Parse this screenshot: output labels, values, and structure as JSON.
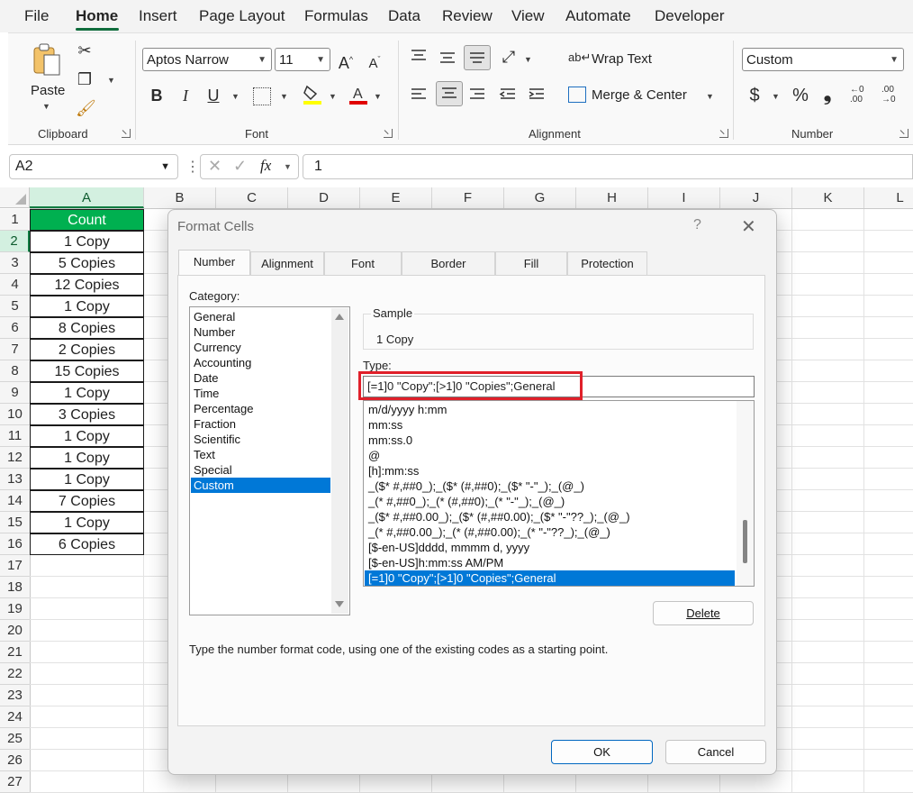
{
  "menu": {
    "tabs": [
      "File",
      "Home",
      "Insert",
      "Page Layout",
      "Formulas",
      "Data",
      "Review",
      "View",
      "Automate",
      "Developer"
    ],
    "active": "Home"
  },
  "ribbon": {
    "clipboard": {
      "paste_label": "Paste",
      "group_label": "Clipboard"
    },
    "font": {
      "font_name": "Aptos Narrow",
      "font_size": "11",
      "group_label": "Font",
      "bold": "B",
      "italic": "I",
      "underline": "U"
    },
    "alignment": {
      "wrap_text": "Wrap Text",
      "merge_center": "Merge & Center",
      "group_label": "Alignment"
    },
    "number": {
      "format": "Custom",
      "currency": "$",
      "percent": "%",
      "comma": "❟",
      "group_label": "Number"
    }
  },
  "formula_bar": {
    "name_box": "A2",
    "fx": "fx",
    "formula": "1"
  },
  "sheet": {
    "columns": [
      "A",
      "B",
      "C",
      "D",
      "E",
      "F",
      "G",
      "H",
      "I",
      "J",
      "K",
      "L"
    ],
    "rows": [
      "1",
      "2",
      "3",
      "4",
      "5",
      "6",
      "7",
      "8",
      "9",
      "10",
      "11",
      "12",
      "13",
      "14",
      "15",
      "16",
      "17",
      "18",
      "19",
      "20",
      "21",
      "22",
      "23",
      "24",
      "25",
      "26",
      "27"
    ],
    "cells": [
      "Count",
      "1 Copy",
      "5 Copies",
      "12 Copies",
      "1 Copy",
      "8 Copies",
      "2 Copies",
      "15 Copies",
      "1 Copy",
      "3 Copies",
      "1 Copy",
      "1 Copy",
      "1 Copy",
      "7 Copies",
      "1 Copy",
      "6 Copies"
    ],
    "header_color": "#00b050"
  },
  "dialog": {
    "title": "Format Cells",
    "help": "?",
    "close": "✕",
    "tabs": [
      "Number",
      "Alignment",
      "Font",
      "Border",
      "Fill",
      "Protection"
    ],
    "active_tab": "Number",
    "category_label": "Category:",
    "categories": [
      "General",
      "Number",
      "Currency",
      "Accounting",
      "Date",
      "Time",
      "Percentage",
      "Fraction",
      "Scientific",
      "Text",
      "Special",
      "Custom"
    ],
    "selected_category": "Custom",
    "sample_label": "Sample",
    "sample_value": "1 Copy",
    "type_label": "Type:",
    "type_value": "[=1]0 \"Copy\";[>1]0 \"Copies\";General",
    "formats": [
      "m/d/yyyy h:mm",
      "mm:ss",
      "mm:ss.0",
      "@",
      "[h]:mm:ss",
      "_($* #,##0_);_($* (#,##0);_($* \"-\"_);_(@_)",
      "_(* #,##0_);_(* (#,##0);_(* \"-\"_);_(@_)",
      "_($* #,##0.00_);_($* (#,##0.00);_($* \"-\"??_);_(@_)",
      "_(* #,##0.00_);_(* (#,##0.00);_(* \"-\"??_);_(@_)",
      "[$-en-US]dddd, mmmm d, yyyy",
      "[$-en-US]h:mm:ss AM/PM",
      "[=1]0 \"Copy\";[>1]0 \"Copies\";General"
    ],
    "delete_label": "Delete",
    "hint": "Type the number format code, using one of the existing codes as a starting point.",
    "ok_label": "OK",
    "cancel_label": "Cancel",
    "accent": "#0078d7",
    "highlight_color": "#e0202a"
  }
}
